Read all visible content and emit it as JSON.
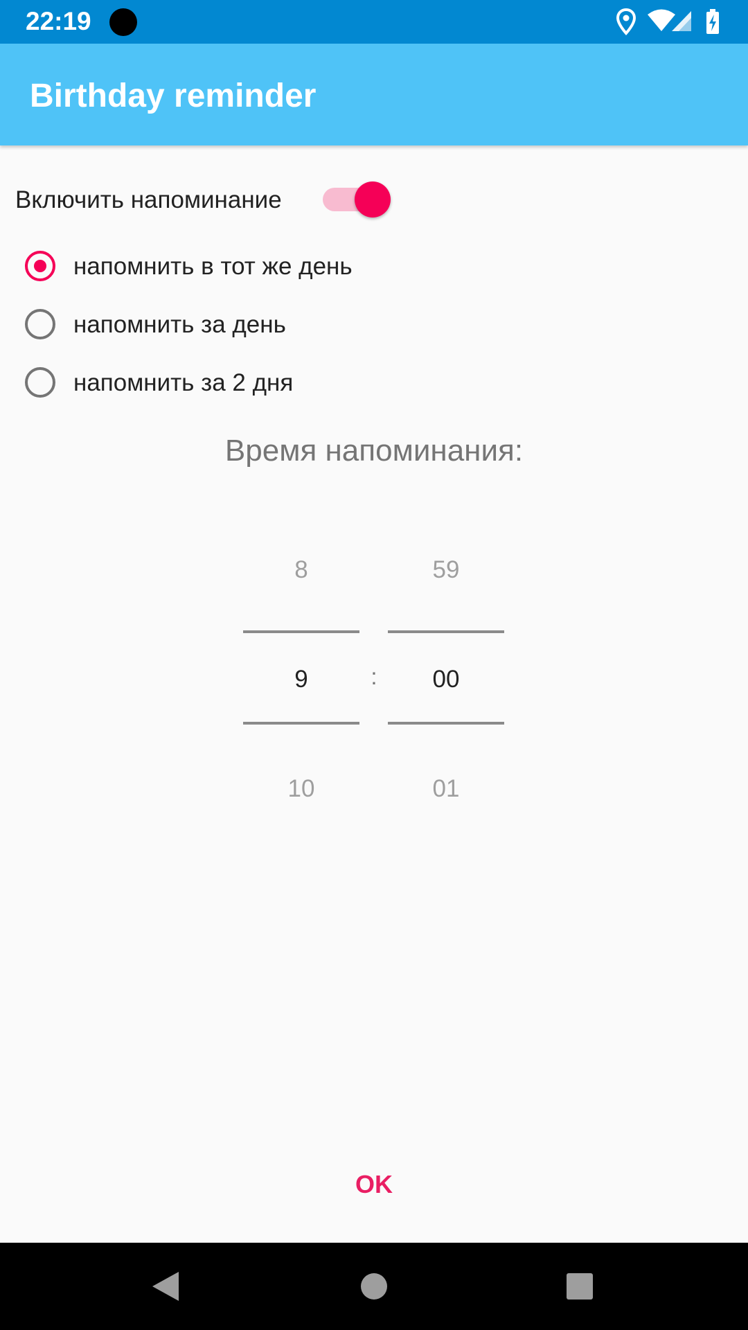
{
  "status_bar": {
    "time": "22:19",
    "icons": [
      "location-icon",
      "wifi-icon",
      "signal-icon",
      "battery-charging-icon"
    ]
  },
  "app_bar": {
    "title": "Birthday reminder"
  },
  "reminder_toggle": {
    "label": "Включить напоминание",
    "enabled": true
  },
  "radio_options": [
    {
      "label": "напомнить в тот же день",
      "checked": true
    },
    {
      "label": "напомнить за день",
      "checked": false
    },
    {
      "label": "напомнить за 2 дня",
      "checked": false
    }
  ],
  "time_section": {
    "title": "Время напоминания:"
  },
  "time_picker": {
    "hour": {
      "prev": "8",
      "current": "9",
      "next": "10"
    },
    "separator": ":",
    "minute": {
      "prev": "59",
      "current": "00",
      "next": "01"
    }
  },
  "ok_button": {
    "label": "OK"
  },
  "colors": {
    "status_bar": "#0288d1",
    "app_bar": "#4fc3f7",
    "accent": "#f50057",
    "ok_text": "#e91e63"
  },
  "nav_bar": {
    "icons": [
      "back-icon",
      "home-icon",
      "recents-icon"
    ]
  }
}
